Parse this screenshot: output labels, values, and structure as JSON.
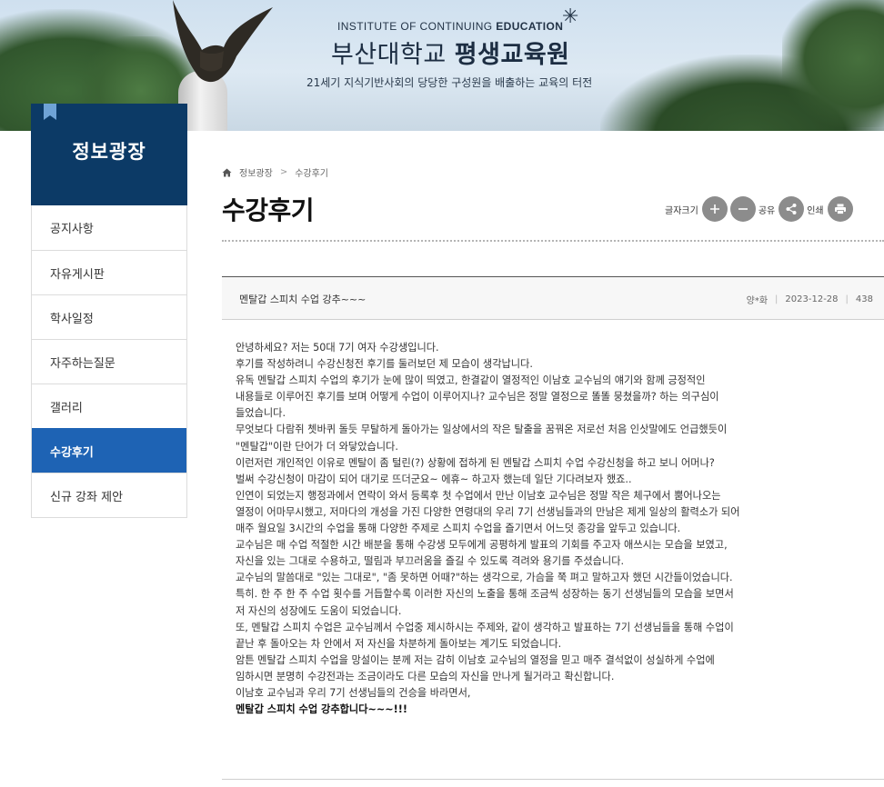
{
  "banner": {
    "institute_en_prefix": "INSTITUTE OF CONTINUING ",
    "institute_en_bold": "EDUCATION",
    "name_regular": "부산대학교 ",
    "name_bold": "평생교육원",
    "slogan": "21세기 지식기반사회의 당당한 구성원을 배출하는 교육의 터전"
  },
  "sidebar": {
    "title": "정보광장",
    "items": [
      {
        "label": "공지사항"
      },
      {
        "label": "자유게시판"
      },
      {
        "label": "학사일정"
      },
      {
        "label": "자주하는질문"
      },
      {
        "label": "갤러리"
      },
      {
        "label": "수강후기",
        "active": true
      },
      {
        "label": "신규 강좌 제안"
      }
    ]
  },
  "breadcrumb": {
    "root": "정보광장",
    "current": "수강후기"
  },
  "page": {
    "title": "수강후기"
  },
  "tools": {
    "font_size_label": "글자크기",
    "share_label": "공유",
    "print_label": "인쇄"
  },
  "post": {
    "title": "멘탈갑 스피치 수업 강추~~~",
    "author": "양*화",
    "date": "2023-12-28",
    "views": "438",
    "body_lines": [
      "안녕하세요?  저는 50대 7기 여자 수강생입니다.",
      "후기를 작성하려니 수강신청전 후기를 둘러보던 제 모습이 생각납니다.",
      "유독 멘탈갑 스피치 수업의 후기가 눈에 많이 띄였고, 한결같이 열정적인 이남호 교수님의 얘기와 함께 긍정적인",
      "내용들로 이루어진 후기를 보며 어떻게 수업이 이루어지나? 교수님은 정말 열정으로 똘똘 뭉쳤을까? 하는 의구심이",
      "들었습니다.",
      "무엇보다 다람쥐 쳇바퀴 돌듯 무탈하게 돌아가는 일상에서의 작은 탈출을 꿈꿔온 저로선 처음 인삿말에도 언급했듯이",
      "\"멘탈갑\"이란 단어가 더 와닿았습니다.",
      "이런저런 개인적인 이유로 멘탈이 좀 털린(?) 상황에 접하게 된 멘탈갑 스피치 수업 수강신청을 하고 보니 어머나?",
      "벌써 수강신청이 마감이 되어 대기로 뜨더군요~ 에휴~ 하고자 했는데 일단 기다려보자 했죠..",
      "인연이 되었는지 행정과에서 연락이 와서 등록후 첫 수업에서 만난 이남호 교수님은 정말 작은 체구에서 뿜어나오는",
      "열정이 어마무시했고, 저마다의 개성을 가진 다양한 연령대의 우리 7기 선생님들과의 만남은 제게 일상의 활력소가 되어",
      "매주 월요일 3시간의 수업을 통해 다양한 주제로 스피치 수업을 즐기면서 어느덧 종강을 앞두고 있습니다.",
      "교수님은 매 수업 적절한 시간 배분을 통해 수강생 모두에게 공평하게 발표의 기회를 주고자 애쓰시는 모습을 보였고,",
      "자신을 있는 그대로 수용하고, 떨림과 부끄러움을 즐길 수 있도록 격려와 용기를 주셨습니다.",
      "교수님의 말씀대로 \"있는 그대로\", \"좀 못하면 어때?\"하는 생각으로, 가슴을 쭉 펴고 말하고자 했던 시간들이었습니다.",
      "특히. 한 주 한 주 수업 횟수를 거듭할수록 이러한 자신의 노출을 통해 조금씩 성장하는 동기 선생님들의 모습을 보면서",
      "저 자신의 성장에도 도움이 되었습니다.",
      "또, 멘탈갑 스피치 수업은 교수님께서 수업중 제시하시는 주제와, 같이 생각하고 발표하는 7기 선생님들을 통해 수업이",
      "끝난 후 돌아오는 차 안에서 저 자신을 차분하게 돌아보는 계기도 되었습니다.",
      "암튼 멘탈갑 스피치 수업을 망설이는 분께 저는 감히 이남호 교수님의 열정을 믿고 매주 결석없이 성실하게 수업에",
      "임하시면 분명히 수강전과는 조금이라도 다른 모습의 자신을 만나게 될거라고 확신합니다.",
      "이남호 교수님과 우리 7기 선생님들의 건승을 바라면서,"
    ],
    "closing_line": "멘탈갑 스피치 수업 강추합니다~~~!!!"
  }
}
